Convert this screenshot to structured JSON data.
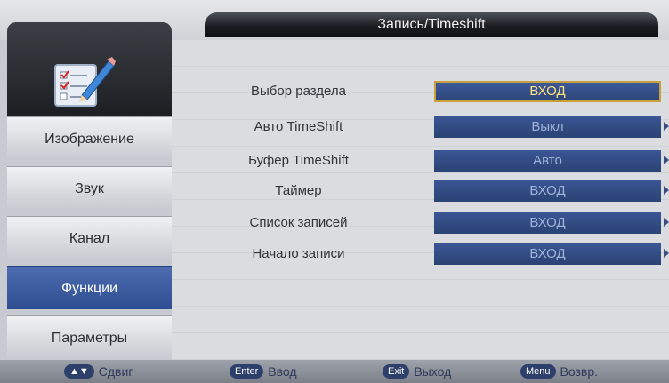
{
  "title": "Запись/Timeshift",
  "sidebar": {
    "icon": "checklist-pencil-icon",
    "items": [
      {
        "label": "Изображение",
        "active": false
      },
      {
        "label": "Звук",
        "active": false
      },
      {
        "label": "Канал",
        "active": false
      },
      {
        "label": "Функции",
        "active": true
      },
      {
        "label": "Параметры",
        "active": false
      }
    ]
  },
  "menu": {
    "rows": [
      {
        "label": "Выбор раздела",
        "value": "ВХОД",
        "selected": true
      },
      {
        "label": "Авто TimeShift",
        "value": "Выкл"
      },
      {
        "label": "Буфер TimeShift",
        "value": "Авто"
      },
      {
        "label": "Таймер",
        "value": "ВХОД"
      },
      {
        "label": "Список записей",
        "value": "ВХОД"
      },
      {
        "label": "Начало записи",
        "value": "ВХОД"
      }
    ]
  },
  "footer": {
    "hints": [
      {
        "key": "▲▼",
        "label": "Сдвиг"
      },
      {
        "key": "Enter",
        "label": "Ввод"
      },
      {
        "key": "Exit",
        "label": "Выход"
      },
      {
        "key": "Menu",
        "label": "Возвр."
      }
    ]
  },
  "colors": {
    "accent": "#2f4d91",
    "selection_border": "#c8a03a",
    "selected_text": "#ffe27a"
  }
}
